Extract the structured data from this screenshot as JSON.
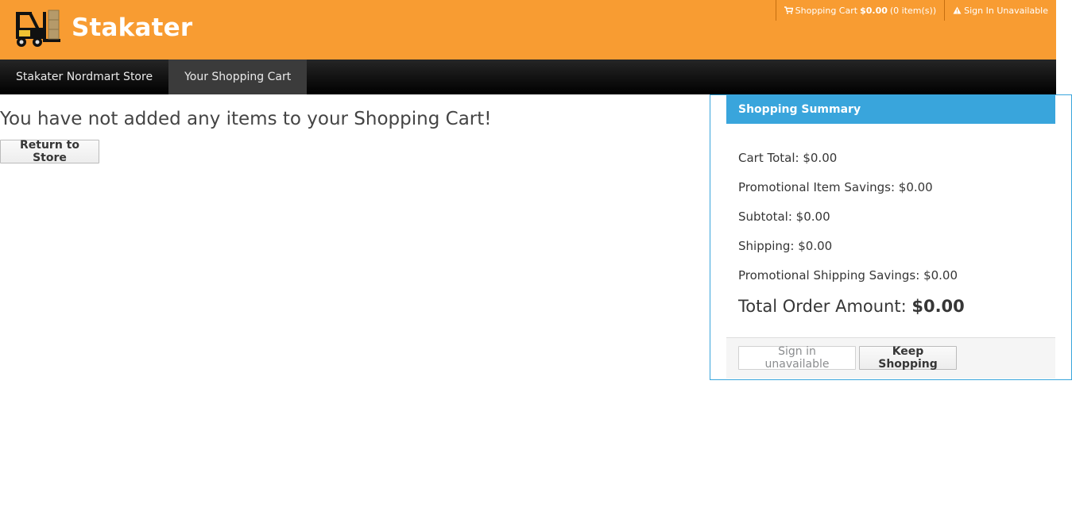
{
  "header": {
    "brand": "Stakater",
    "logo_icon": "forklift-icon",
    "brand_color": "#f89c32",
    "utility": {
      "cart_icon": "shopping-cart-icon",
      "cart_label": "Shopping Cart",
      "cart_total": "$0.00",
      "cart_items": "(0 item(s))",
      "signin_icon": "warning-icon",
      "signin_label": "Sign In Unavailable"
    }
  },
  "nav": {
    "items": [
      {
        "label": "Stakater Nordmart Store",
        "active": false
      },
      {
        "label": "Your Shopping Cart",
        "active": true
      }
    ]
  },
  "main": {
    "empty_message": "You have not added any items to your Shopping Cart!",
    "return_button": "Return to Store"
  },
  "summary": {
    "title": "Shopping Summary",
    "accent_color": "#39a5dc",
    "lines": [
      "Cart Total: $0.00",
      "Promotional Item Savings: $0.00",
      "Subtotal: $0.00",
      "Shipping: $0.00",
      "Promotional Shipping Savings: $0.00"
    ],
    "total_label": "Total Order Amount:",
    "total_value": "$0.00",
    "signin_button": "Sign in unavailable",
    "keep_shopping_button": "Keep Shopping"
  }
}
